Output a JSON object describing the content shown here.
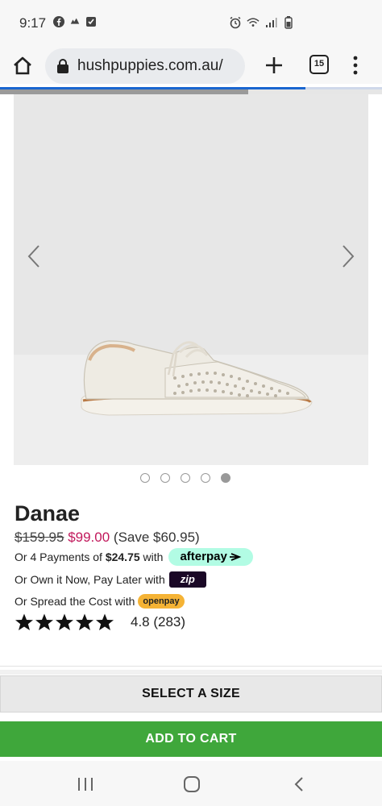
{
  "status_bar": {
    "time": "9:17"
  },
  "browser": {
    "url": "hushpuppies.com.au/",
    "tab_count": "15",
    "load_progress_percent": 80
  },
  "gallery": {
    "slide_count": 5,
    "active_slide": 5
  },
  "product": {
    "name": "Danae",
    "old_price": "$159.95",
    "new_price": "$99.00",
    "save_text": "(Save $60.95)",
    "afterpay_prefix": "Or 4 Payments of",
    "afterpay_amount": "$24.75",
    "afterpay_suffix": "with",
    "afterpay_logo": "afterpay",
    "zip_text": "Or Own it Now, Pay Later with",
    "zip_logo": "zip",
    "openpay_text": "Or Spread the Cost with",
    "openpay_logo": "openpay",
    "rating_value": 4.8,
    "rating_text": "4.8 (283)",
    "stars": 5
  },
  "actions": {
    "select_size": "SELECT A SIZE",
    "add_to_cart": "ADD TO CART"
  },
  "colors": {
    "sale_price": "#c1185b",
    "add_to_cart_bg": "#3fa73b",
    "afterpay_bg": "#b2fce4",
    "openpay_bg": "#f5b335",
    "zip_bg": "#1a0826",
    "progress": "#1a66d0"
  },
  "icons": {
    "status_left": [
      "facebook-icon",
      "weather-icon",
      "check-box-icon"
    ],
    "status_right": [
      "alarm-icon",
      "wifi-icon",
      "signal-icon",
      "battery-icon"
    ],
    "browser": [
      "home-icon",
      "lock-icon",
      "plus-icon",
      "tabs-icon",
      "more-vert-icon"
    ],
    "gallery": [
      "chevron-left-icon",
      "chevron-right-icon"
    ],
    "nav": [
      "recents-icon",
      "home-circle-icon",
      "back-icon"
    ]
  }
}
